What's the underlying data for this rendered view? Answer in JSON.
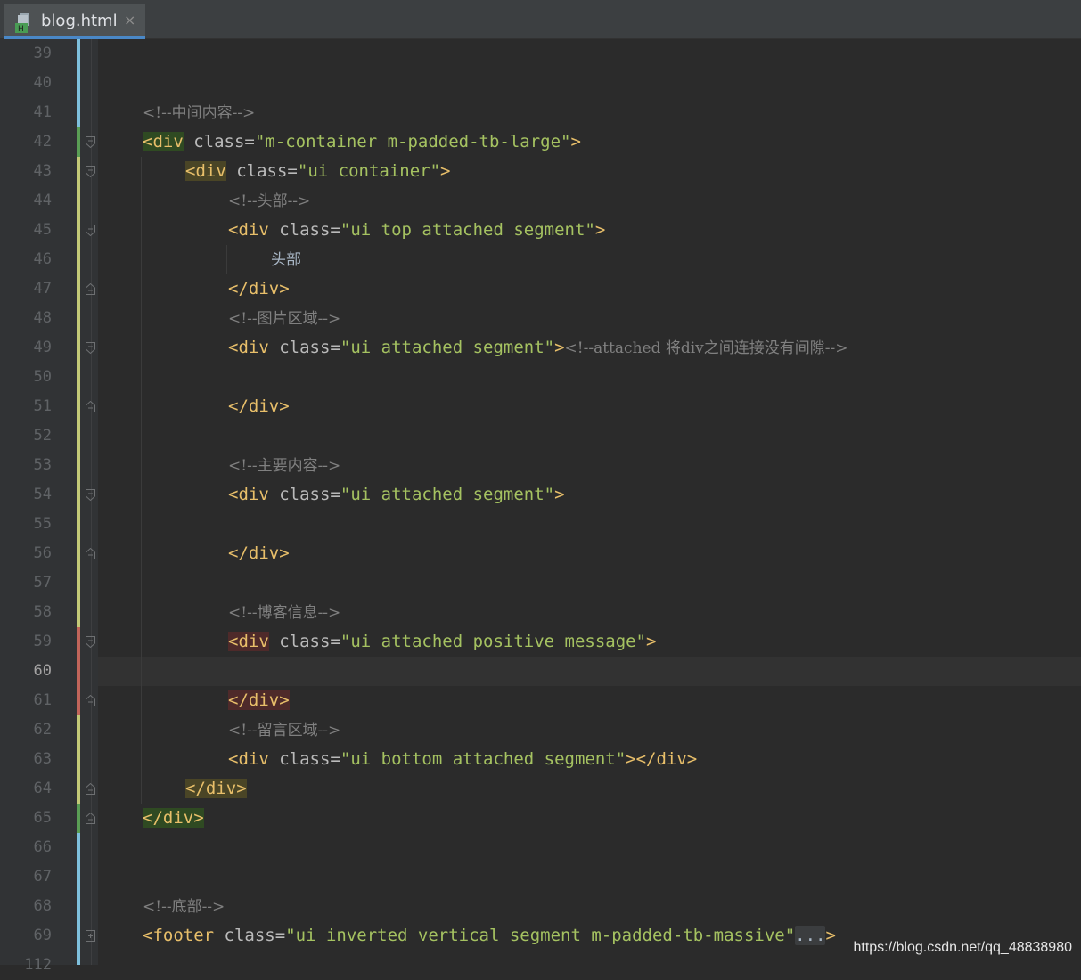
{
  "tab": {
    "filename": "blog.html",
    "close_glyph": "×",
    "icon": "html-file-icon"
  },
  "colors": {
    "background": "#2b2b2b",
    "gutter": "#313335",
    "tag": "#e8bf6a",
    "attribute": "#bababa",
    "value": "#a5c261",
    "comment": "#808080",
    "change_added": "#5a9e55",
    "change_modified": "#c3c977",
    "change_deleted": "#c1655a",
    "vcs_bar": "#7ec0dd"
  },
  "editor": {
    "line_numbers": [
      "39",
      "40",
      "41",
      "42",
      "43",
      "44",
      "45",
      "46",
      "47",
      "48",
      "49",
      "50",
      "51",
      "52",
      "53",
      "54",
      "55",
      "56",
      "57",
      "58",
      "59",
      "60",
      "61",
      "62",
      "63",
      "64",
      "65",
      "66",
      "67",
      "68",
      "69",
      "112"
    ],
    "current_line": "60",
    "lines": {
      "l41": {
        "comment": "<!--中间内容-->"
      },
      "l42": {
        "tag_open": "<div",
        "attr": "class",
        "eq": "=",
        "value": "\"m-container m-padded-tb-large\"",
        "tag_close": ">"
      },
      "l43": {
        "tag_open": "<div",
        "attr": "class",
        "eq": "=",
        "value": "\"ui container\"",
        "tag_close": ">"
      },
      "l44": {
        "comment": "<!--头部-->"
      },
      "l45": {
        "tag_open": "<div",
        "attr": "class",
        "eq": "=",
        "value": "\"ui top attached segment\"",
        "tag_close": ">"
      },
      "l46": {
        "text": "头部"
      },
      "l47": {
        "tag": "</div>"
      },
      "l48": {
        "comment": "<!--图片区域-->"
      },
      "l49": {
        "tag_open": "<div",
        "attr": "class",
        "eq": "=",
        "value": "\"ui attached segment\"",
        "tag_close": ">",
        "comment": "<!--attached 将div之间连接没有间隙-->"
      },
      "l51": {
        "tag": "</div>"
      },
      "l53": {
        "comment": "<!--主要内容-->"
      },
      "l54": {
        "tag_open": "<div",
        "attr": "class",
        "eq": "=",
        "value": "\"ui attached segment\"",
        "tag_close": ">"
      },
      "l56": {
        "tag": "</div>"
      },
      "l58": {
        "comment": "<!--博客信息-->"
      },
      "l59": {
        "tag_open": "<div",
        "attr": "class",
        "eq": "=",
        "value": "\"ui attached positive message\"",
        "tag_close": ">"
      },
      "l61": {
        "tag": "</div>"
      },
      "l62": {
        "comment": "<!--留言区域-->"
      },
      "l63": {
        "tag_open": "<div",
        "attr": "class",
        "eq": "=",
        "value": "\"ui bottom attached segment\"",
        "tag_close": "></div>"
      },
      "l64": {
        "tag": "</div>"
      },
      "l65": {
        "tag": "</div>"
      },
      "l68": {
        "comment": "<!--底部-->"
      },
      "l69": {
        "tag_open": "<footer",
        "attr": "class",
        "eq": "=",
        "value": "\"ui inverted vertical segment m-padded-tb-massive\"",
        "fold": "...",
        "tag_close": ">"
      }
    }
  },
  "watermark": "https://blog.csdn.net/qq_48838980"
}
